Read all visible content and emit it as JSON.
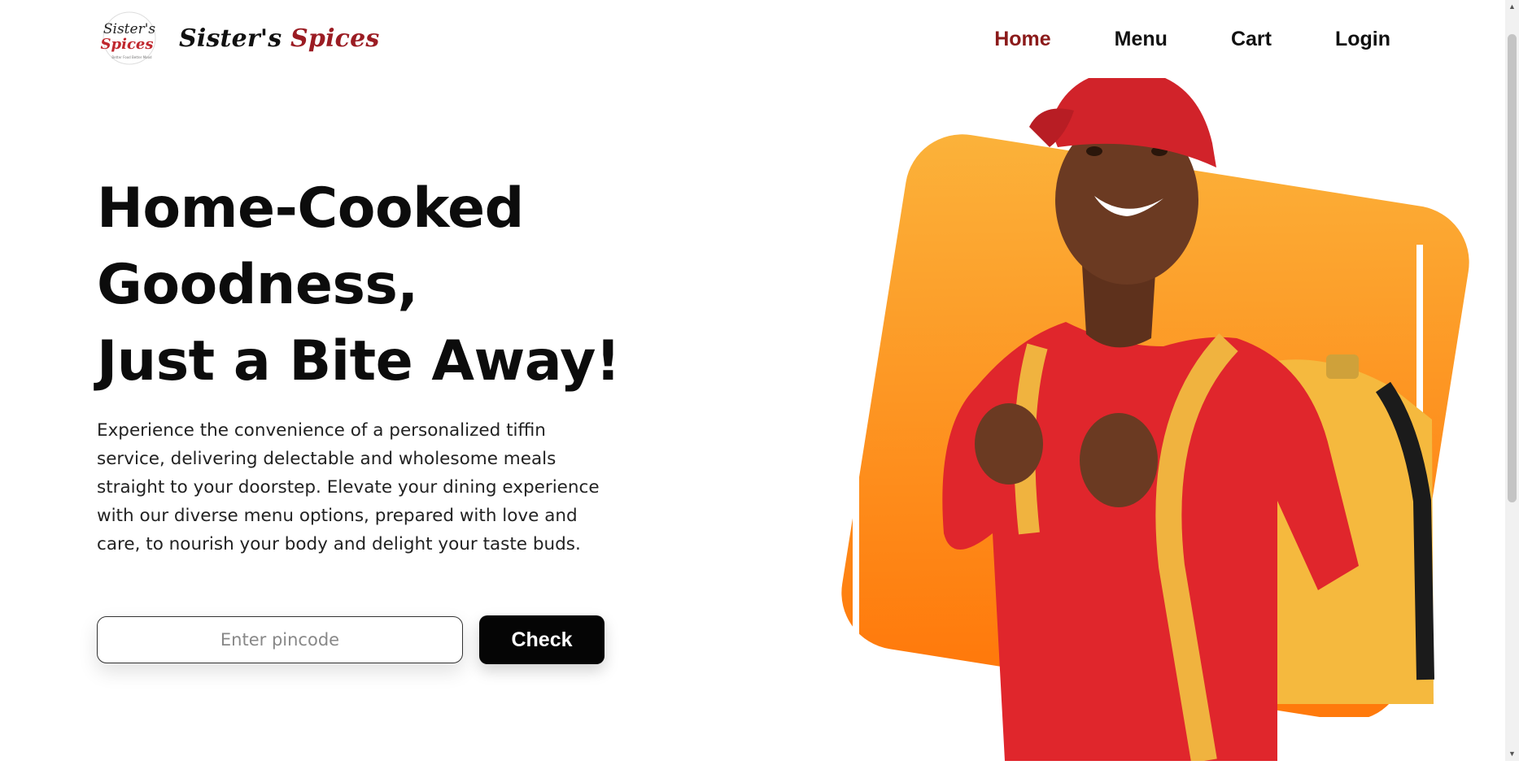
{
  "header": {
    "logo_text_line1": "Sister's",
    "logo_text_line2": "Spices",
    "logo_tagline": "Better Food Better Mood",
    "brand_prefix": "Sister's ",
    "brand_accent": "Spices",
    "nav": [
      {
        "label": "Home",
        "active": true
      },
      {
        "label": "Menu",
        "active": false
      },
      {
        "label": "Cart",
        "active": false
      },
      {
        "label": "Login",
        "active": false
      }
    ]
  },
  "hero": {
    "title_lines": [
      "Home-Cooked",
      "Goodness,",
      "Just a Bite Away!"
    ],
    "description": "Experience the convenience of a personalized tiffin service, delivering delectable and wholesome meals straight to your doorstep. Elevate your dining experience with our diverse menu options, prepared with love and care, to nourish your body and delight your taste buds.",
    "pincode_placeholder": "Enter pincode",
    "pincode_value": "",
    "check_label": "Check"
  },
  "colors": {
    "accent": "#8b1a1a",
    "orange_gradient_top": "#fbb33b",
    "orange_gradient_bottom": "#ff7a0c",
    "button": "#050505"
  },
  "icons": {
    "logo": "sisters-spices-logo",
    "scroll_up": "chevron-up-icon",
    "scroll_down": "chevron-down-icon"
  }
}
